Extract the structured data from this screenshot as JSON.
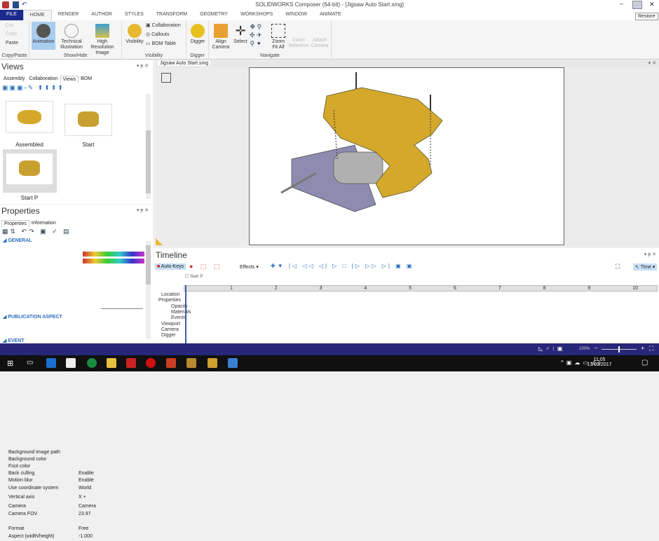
{
  "window": {
    "title": "SOLIDWORKS Composer (64-bit) - [Jigsaw Auto Start.smg]",
    "tooltip": "Restore"
  },
  "tabs": [
    "FILE",
    "HOME",
    "RENDER",
    "AUTHOR",
    "STYLES",
    "TRANSFORM",
    "GEOMETRY",
    "WORKSHOPS",
    "WINDOW",
    "ANIMATE"
  ],
  "ribbon": {
    "copy_paste": {
      "label": "Copy/Paste",
      "cut": "Cut",
      "copy": "Copy",
      "paste": "Paste"
    },
    "show_hide": {
      "label": "Show/Hide",
      "animation": "Animation",
      "technical": "Technical Illustration",
      "hires": "High Resolution Image"
    },
    "visibility": {
      "label": "Visibility",
      "visibility": "Visibility",
      "collaboration": "Collaboration",
      "callouts": "Callouts",
      "bom": "BOM Table"
    },
    "digger": {
      "label": "Digger",
      "digger": "Digger"
    },
    "navigate": {
      "label": "Navigate",
      "align": "Align Camera",
      "select": "Select",
      "zoomfit": "Zoom Fit All",
      "zoomsel": "Zoom Selection",
      "attach": "Attach Camera"
    }
  },
  "views": {
    "title": "Views",
    "tabs": [
      "Assembly",
      "Collaboration",
      "Views",
      "BOM"
    ],
    "items": [
      "Assembled",
      "Start",
      "Start P"
    ]
  },
  "document": {
    "tab": "Jigsaw Auto Start.smg"
  },
  "properties": {
    "title": "Properties",
    "tabs": [
      "Properties",
      "Information"
    ],
    "sections": {
      "general": "GENERAL",
      "publication": "PUBLICATION ASPECT",
      "event": "EVENT"
    },
    "rows": [
      {
        "name": "Background image path",
        "value": ""
      },
      {
        "name": "Background color",
        "value": ""
      },
      {
        "name": "Foot color",
        "value": ""
      },
      {
        "name": "Back culling",
        "value": "Enable"
      },
      {
        "name": "Motion blur",
        "value": "Enable"
      },
      {
        "name": "Use coordinate system",
        "value": "World"
      },
      {
        "name": "Vertical axis",
        "value": "X +"
      },
      {
        "name": "Camera",
        "value": "Camera"
      },
      {
        "name": "Camera FOV",
        "value": "23.97"
      }
    ],
    "pub_rows": [
      {
        "name": "Format",
        "value": "Free"
      },
      {
        "name": "Aspect (width/height)",
        "value": "-1.000"
      }
    ]
  },
  "timeline": {
    "title": "Timeline",
    "autokeys": "Auto-Keys",
    "effects": "Effects",
    "time": "Time",
    "marker": "Start P",
    "ticks": [
      "1",
      "2",
      "3",
      "4",
      "5",
      "6",
      "7",
      "8",
      "9",
      "10"
    ],
    "tracks": [
      "Location",
      "Properties",
      "Opacity",
      "Materials",
      "Events",
      "Viewport",
      "Camera",
      "Digger"
    ]
  },
  "status": {
    "zoom": "100%"
  },
  "taskbar": {
    "time": "11:05",
    "date": "13/09/2017"
  },
  "colors": {
    "file_tab": "#1b2a8c",
    "status_bar": "#27277a",
    "housing": "#d4a82a",
    "base": "#8e8bb0"
  }
}
